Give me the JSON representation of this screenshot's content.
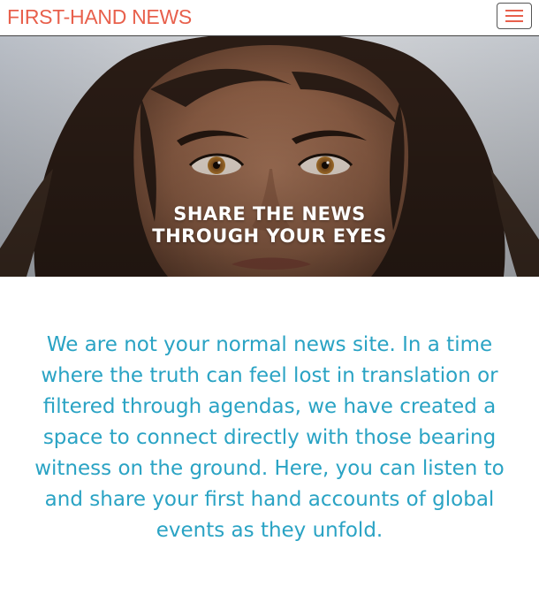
{
  "navbar": {
    "brand": "FIRST-HAND NEWS",
    "menu_toggle_icon": "hamburger-menu-icon",
    "brand_color": "#e8604c"
  },
  "hero": {
    "headline_line1": "SHARE THE NEWS",
    "headline_line2": "THROUGH YOUR EYES",
    "image_subject": "portrait-photo"
  },
  "intro": {
    "text": "We are not your normal news site. In a time where the truth can feel lost in translation or filtered through agendas, we have created a space to connect directly with those bearing witness on the ground. Here, you can listen to and share your first hand accounts of global events as they unfold.",
    "text_color": "#2aa3c4"
  }
}
